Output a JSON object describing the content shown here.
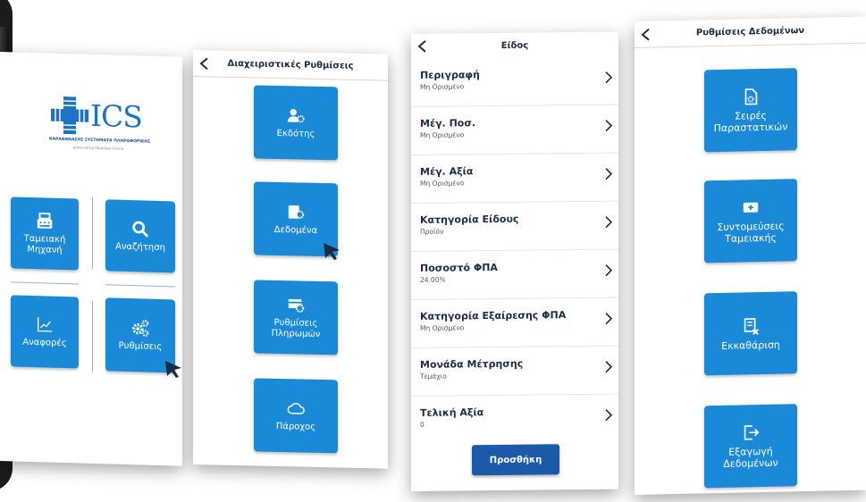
{
  "colors": {
    "tile": "#1a8ad8",
    "title": "#1a2b44",
    "add_button": "#1a5aa8"
  },
  "home": {
    "logo": {
      "text": "ICS",
      "subtitle": "ΚΑΡΑΘΑΝΑΣΗΣ ΣΥΣΤΗΜΑΤΑ ΠΛΗΡΟΦΟΡΙΚΗΣ",
      "powered": "powered by Paradisis Online"
    },
    "tiles": [
      {
        "label": "Ταμειακή Μηχανή",
        "icon": "cash-register-icon"
      },
      {
        "label": "Αναζήτηση",
        "icon": "search-icon"
      },
      {
        "label": "Αναφορές",
        "icon": "chart-icon"
      },
      {
        "label": "Ρυθμίσεις",
        "icon": "gears-icon"
      }
    ]
  },
  "admin": {
    "title": "Διαχειριστικές Ρυθμίσεις",
    "tiles": [
      {
        "label": "Εκδότης",
        "icon": "user-gear-icon"
      },
      {
        "label": "Δεδομένα",
        "icon": "data-gear-icon"
      },
      {
        "label": "Ρυθμίσεις Πληρωμών",
        "icon": "payment-gear-icon"
      },
      {
        "label": "Πάροχος",
        "icon": "cloud-icon"
      }
    ]
  },
  "item": {
    "title": "Είδος",
    "fields": [
      {
        "label": "Περιγραφή",
        "value": "Μη Ορισμένο"
      },
      {
        "label": "Μέγ. Ποσ.",
        "value": "Μη Ορισμένο"
      },
      {
        "label": "Μέγ. Αξία",
        "value": "Μη Ορισμένο"
      },
      {
        "label": "Κατηγορία Είδους",
        "value": "Προϊόν"
      },
      {
        "label": "Ποσοστό ΦΠΑ",
        "value": "24.00%"
      },
      {
        "label": "Κατηγορία Εξαίρεσης ΦΠΑ",
        "value": "Μη Ορισμένο"
      },
      {
        "label": "Μονάδα Μέτρησης",
        "value": "Τεμάχιο"
      },
      {
        "label": "Τελική Αξία",
        "value": "0"
      }
    ],
    "add_label": "Προσθήκη"
  },
  "data_settings": {
    "title": "Ρυθμίσεις Δεδομένων",
    "tiles": [
      {
        "label": "Σειρές Παραστατικών",
        "icon": "document-gear-icon"
      },
      {
        "label": "Συντομεύσεις Ταμειακής",
        "icon": "shortcut-plus-icon"
      },
      {
        "label": "Εκκαθάριση",
        "icon": "clear-list-icon"
      },
      {
        "label": "Εξαγωγή Δεδομένων",
        "icon": "export-icon"
      }
    ]
  }
}
